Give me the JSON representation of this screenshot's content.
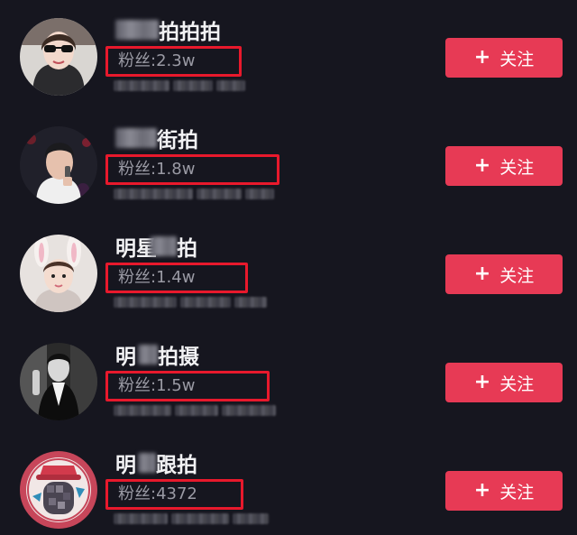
{
  "accounts": [
    {
      "name_prefix_hidden": true,
      "name_visible": "拍拍拍",
      "name_suffix_hidden": false,
      "fans": "粉丝:2.3w",
      "follow_label": "关注",
      "follow_icon": "plus-icon",
      "avatar_desc": "woman-with-sunglasses"
    },
    {
      "name_prefix_hidden": true,
      "name_visible": "街拍",
      "name_suffix_hidden": false,
      "fans": "粉丝:1.8w",
      "follow_label": "关注",
      "follow_icon": "plus-icon",
      "avatar_desc": "male-performer-with-microphone"
    },
    {
      "name_visible": "明星",
      "name_middle_hidden": true,
      "name_end": "拍",
      "fans": "粉丝:1.4w",
      "follow_label": "关注",
      "follow_icon": "plus-icon",
      "avatar_desc": "girl-with-bunny-ears"
    },
    {
      "name_visible": "明",
      "name_middle_hidden": true,
      "name_end": "拍摄",
      "fans": "粉丝:1.5w",
      "follow_label": "关注",
      "follow_icon": "plus-icon",
      "avatar_desc": "black-and-white-photo"
    },
    {
      "name_visible": "明",
      "name_middle_hidden": true,
      "name_end": "跟拍",
      "fans": "粉丝:4372",
      "follow_label": "关注",
      "follow_icon": "plus-icon",
      "avatar_desc": "cartoon-character-pixelated"
    }
  ],
  "colors": {
    "background": "#16161f",
    "follow_button": "#e73a55",
    "highlight_box": "#e8192c",
    "fans_text": "#9a9aa4"
  }
}
